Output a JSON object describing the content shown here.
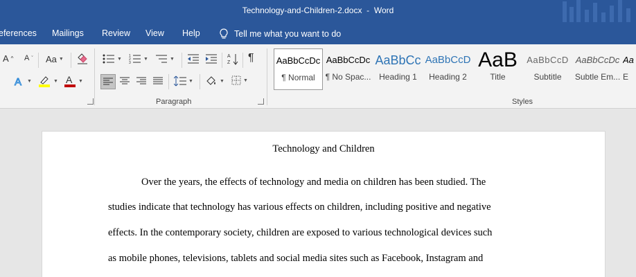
{
  "titlebar": {
    "document": "Technology-and-Children-2.docx",
    "separator": "-",
    "app": "Word"
  },
  "menu": {
    "items": [
      "eferences",
      "Mailings",
      "Review",
      "View",
      "Help"
    ],
    "tell_me": "Tell me what you want to do",
    "tell_icon": "lightbulb-icon"
  },
  "ribbon": {
    "font_group": {
      "case_label": "Aa",
      "grow": "A",
      "shrink": "A"
    },
    "paragraph_label": "Paragraph",
    "styles_label": "Styles",
    "styles": [
      {
        "preview": "AaBbCcDc",
        "name": "¶ Normal"
      },
      {
        "preview": "AaBbCcDc",
        "name": "¶ No Spac..."
      },
      {
        "preview": "AaBbCc",
        "name": "Heading 1"
      },
      {
        "preview": "AaBbCcD",
        "name": "Heading 2"
      },
      {
        "preview": "AaB",
        "name": "Title"
      },
      {
        "preview": "AaBbCcD",
        "name": "Subtitle"
      },
      {
        "preview": "AaBbCcDc",
        "name": "Subtle Em..."
      },
      {
        "preview": "Aa",
        "name": "E"
      }
    ],
    "colors": {
      "highlight": "#ffff00",
      "font_color": "#c00000",
      "accent": "#2b579a",
      "heading": "#2e74b5"
    }
  },
  "document": {
    "title": "Technology and Children",
    "lines": [
      "Over the years, the effects of technology and media on children has been studied. The",
      "studies indicate that technology has various effects on children, including positive and negative",
      "effects. In the contemporary society, children are exposed to various technological devices such",
      "as mobile phones, televisions, tablets and social media sites such as Facebook, Instagram and"
    ]
  }
}
